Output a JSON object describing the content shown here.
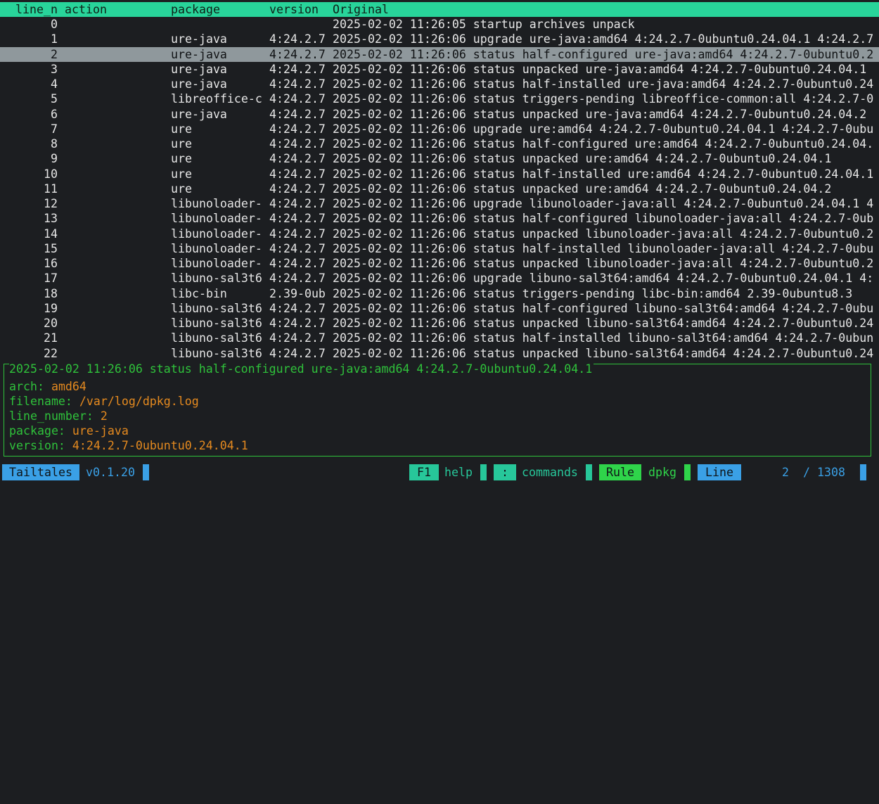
{
  "columns": {
    "line_n": "line_n",
    "action": "action",
    "package": "package",
    "version": "version",
    "original": "Original"
  },
  "selected_index": 2,
  "rows": [
    {
      "line": "0",
      "package": "",
      "version": "",
      "original": "2025-02-02 11:26:05 startup archives unpack"
    },
    {
      "line": "1",
      "package": "ure-java",
      "version": "4:24.2.7",
      "original": "2025-02-02 11:26:06 upgrade ure-java:amd64 4:24.2.7-0ubuntu0.24.04.1 4:24.2.7"
    },
    {
      "line": "2",
      "package": "ure-java",
      "version": "4:24.2.7",
      "original": "2025-02-02 11:26:06 status half-configured ure-java:amd64 4:24.2.7-0ubuntu0.2"
    },
    {
      "line": "3",
      "package": "ure-java",
      "version": "4:24.2.7",
      "original": "2025-02-02 11:26:06 status unpacked ure-java:amd64 4:24.2.7-0ubuntu0.24.04.1"
    },
    {
      "line": "4",
      "package": "ure-java",
      "version": "4:24.2.7",
      "original": "2025-02-02 11:26:06 status half-installed ure-java:amd64 4:24.2.7-0ubuntu0.24"
    },
    {
      "line": "5",
      "package": "libreoffice-c",
      "version": "4:24.2.7",
      "original": "2025-02-02 11:26:06 status triggers-pending libreoffice-common:all 4:24.2.7-0"
    },
    {
      "line": "6",
      "package": "ure-java",
      "version": "4:24.2.7",
      "original": "2025-02-02 11:26:06 status unpacked ure-java:amd64 4:24.2.7-0ubuntu0.24.04.2"
    },
    {
      "line": "7",
      "package": "ure",
      "version": "4:24.2.7",
      "original": "2025-02-02 11:26:06 upgrade ure:amd64 4:24.2.7-0ubuntu0.24.04.1 4:24.2.7-0ubu"
    },
    {
      "line": "8",
      "package": "ure",
      "version": "4:24.2.7",
      "original": "2025-02-02 11:26:06 status half-configured ure:amd64 4:24.2.7-0ubuntu0.24.04."
    },
    {
      "line": "9",
      "package": "ure",
      "version": "4:24.2.7",
      "original": "2025-02-02 11:26:06 status unpacked ure:amd64 4:24.2.7-0ubuntu0.24.04.1"
    },
    {
      "line": "10",
      "package": "ure",
      "version": "4:24.2.7",
      "original": "2025-02-02 11:26:06 status half-installed ure:amd64 4:24.2.7-0ubuntu0.24.04.1"
    },
    {
      "line": "11",
      "package": "ure",
      "version": "4:24.2.7",
      "original": "2025-02-02 11:26:06 status unpacked ure:amd64 4:24.2.7-0ubuntu0.24.04.2"
    },
    {
      "line": "12",
      "package": "libunoloader-",
      "version": "4:24.2.7",
      "original": "2025-02-02 11:26:06 upgrade libunoloader-java:all 4:24.2.7-0ubuntu0.24.04.1 4"
    },
    {
      "line": "13",
      "package": "libunoloader-",
      "version": "4:24.2.7",
      "original": "2025-02-02 11:26:06 status half-configured libunoloader-java:all 4:24.2.7-0ub"
    },
    {
      "line": "14",
      "package": "libunoloader-",
      "version": "4:24.2.7",
      "original": "2025-02-02 11:26:06 status unpacked libunoloader-java:all 4:24.2.7-0ubuntu0.2"
    },
    {
      "line": "15",
      "package": "libunoloader-",
      "version": "4:24.2.7",
      "original": "2025-02-02 11:26:06 status half-installed libunoloader-java:all 4:24.2.7-0ubu"
    },
    {
      "line": "16",
      "package": "libunoloader-",
      "version": "4:24.2.7",
      "original": "2025-02-02 11:26:06 status unpacked libunoloader-java:all 4:24.2.7-0ubuntu0.2"
    },
    {
      "line": "17",
      "package": "libuno-sal3t6",
      "version": "4:24.2.7",
      "original": "2025-02-02 11:26:06 upgrade libuno-sal3t64:amd64 4:24.2.7-0ubuntu0.24.04.1 4:"
    },
    {
      "line": "18",
      "package": "libc-bin",
      "version": "2.39-0ub",
      "original": "2025-02-02 11:26:06 status triggers-pending libc-bin:amd64 2.39-0ubuntu8.3"
    },
    {
      "line": "19",
      "package": "libuno-sal3t6",
      "version": "4:24.2.7",
      "original": "2025-02-02 11:26:06 status half-configured libuno-sal3t64:amd64 4:24.2.7-0ubu"
    },
    {
      "line": "20",
      "package": "libuno-sal3t6",
      "version": "4:24.2.7",
      "original": "2025-02-02 11:26:06 status unpacked libuno-sal3t64:amd64 4:24.2.7-0ubuntu0.24"
    },
    {
      "line": "21",
      "package": "libuno-sal3t6",
      "version": "4:24.2.7",
      "original": "2025-02-02 11:26:06 status half-installed libuno-sal3t64:amd64 4:24.2.7-0ubun"
    },
    {
      "line": "22",
      "package": "libuno-sal3t6",
      "version": "4:24.2.7",
      "original": "2025-02-02 11:26:06 status unpacked libuno-sal3t64:amd64 4:24.2.7-0ubuntu0.24"
    }
  ],
  "detail": {
    "title": "2025-02-02 11:26:06 status half-configured ure-java:amd64 4:24.2.7-0ubuntu0.24.04.1",
    "fields": [
      {
        "key": "arch: ",
        "value": "amd64"
      },
      {
        "key": "filename: ",
        "value": "/var/log/dpkg.log"
      },
      {
        "key": "line_number: ",
        "value": "2"
      },
      {
        "key": "package: ",
        "value": "ure-java"
      },
      {
        "key": "version: ",
        "value": "4:24.2.7-0ubuntu0.24.04.1"
      }
    ]
  },
  "status": {
    "app_name": "Tailtales",
    "version": "v0.1.20",
    "f1_key": "F1",
    "help_label": "help",
    "cmd_key": ":",
    "commands_label": "commands",
    "rule_label": "Rule",
    "rule_value": "dpkg",
    "mode_label": "Line",
    "position": "2",
    "separator": "/",
    "total": "1308"
  }
}
